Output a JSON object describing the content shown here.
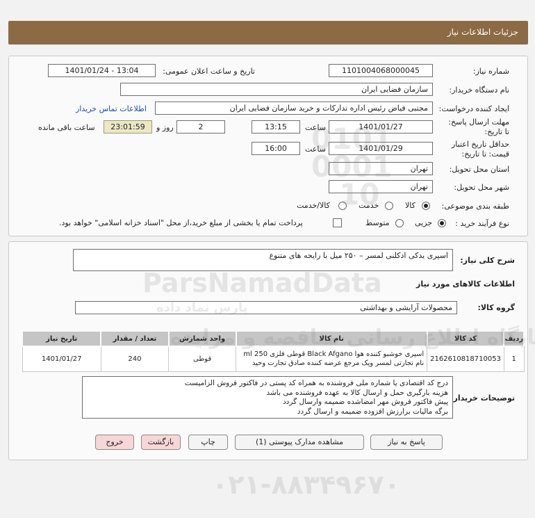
{
  "header": {
    "title": "جزئیات اطلاعات نیاز"
  },
  "need_number": {
    "label": "شماره نیاز:",
    "value": "1101004068000045"
  },
  "announce": {
    "label": "تاریخ و ساعت اعلان عمومی:",
    "value": "1401/01/24 - 13:04"
  },
  "buyer_org": {
    "label": "نام دستگاه خریدار:",
    "value": "سازمان فضایی ایران"
  },
  "creator": {
    "label": "ایجاد کننده درخواست:",
    "value": "مجتبی  فیاض رئیس اداره تدارکات و خرید سازمان فضایی ایران",
    "contact_link": "اطلاعات تماس خریدار"
  },
  "reply_deadline": {
    "label": "مهلت ارسال پاسخ: تا تاریخ:",
    "date": "1401/01/27",
    "time_label": "ساعت",
    "time": "13:15",
    "days": "2",
    "days_label": "روز و",
    "remaining": "23:01:59",
    "remaining_label": "ساعت باقی مانده"
  },
  "price_validity": {
    "label": "حداقل تاریخ اعتبار قیمت: تا تاریخ:",
    "date": "1401/01/29",
    "time_label": "ساعت",
    "time": "16:00"
  },
  "province": {
    "label": "استان محل تحویل:",
    "value": "تهران"
  },
  "city": {
    "label": "شهر محل تحویل:",
    "value": "تهران"
  },
  "category": {
    "label": "طبقه بندی موضوعی:",
    "options": [
      "کالا",
      "خدمت",
      "کالا/خدمت"
    ],
    "selected": "کالا"
  },
  "process": {
    "label": "نوع فرآیند خرید :",
    "options": [
      "جزیی",
      "متوسط"
    ],
    "selected": "جزیی",
    "payment_note": "پرداخت تمام یا بخشی از مبلغ خرید،از محل \"اسناد خزانه اسلامی\" خواهد بود."
  },
  "summary": {
    "label": "شرح کلی نیاز:",
    "value": "اسپری یدکی ادکلنی لمسر – ۲۵۰ میل با رایحه های متنوع"
  },
  "goods_info_title": "اطلاعات کالاهای مورد نیاز",
  "goods_group": {
    "label": "گروه کالا:",
    "value": "محصولات آرایشی و بهداشتی"
  },
  "table": {
    "headers": [
      "ردیف",
      "کد کالا",
      "نام کالا",
      "واحد شمارش",
      "تعداد / مقدار",
      "تاریخ نیاز"
    ],
    "rows": [
      {
        "row": "1",
        "code": "2162610818710053",
        "name_line1": "اسپری خوشبو کننده هوا Black Afgano قوطی فلزی 250 ml",
        "name_line2": "نام تجارتی لمسر ویک مرجع عرضه کننده صادق تجارت وحید",
        "unit": "قوطی",
        "qty": "240",
        "date": "1401/01/27"
      }
    ]
  },
  "buyer_notes": {
    "label": "توضیحات خریدار:",
    "lines": [
      "درج کد اقتصادی یا شماره ملی فروشنده به همراه کد پستی در فاکتور فروش الزامیست",
      "هزینه بارگیری حمل و ارسال کالا به عهده فروشنده می باشد",
      "پیش فاکتور فروش مهر امضاشده ضمیمه وارسال گردد",
      "برگه مالیات برارزش افزوده ضمیمه و ارسال گردد"
    ]
  },
  "buttons": {
    "reply": "پاسخ به نیاز",
    "attachments": "مشاهده مدارک پیوستی (1)",
    "print": "چاپ",
    "back": "بازگشت",
    "exit": "خروج"
  },
  "watermark": {
    "brand": "ParsNamadData",
    "brand_fa": "پارس نماد داده",
    "site": "پایگاه اطلاع رسانی مناقصه و مزایده",
    "phone": "۰۲۱-۸۸۳۴۹۶۷۰",
    "num1": "0101",
    "num2": "0001",
    "num3": "10"
  },
  "colors": {
    "header": "#8b6a44",
    "link": "#1a4fb0",
    "remaining_bg": "#ece8c4"
  }
}
